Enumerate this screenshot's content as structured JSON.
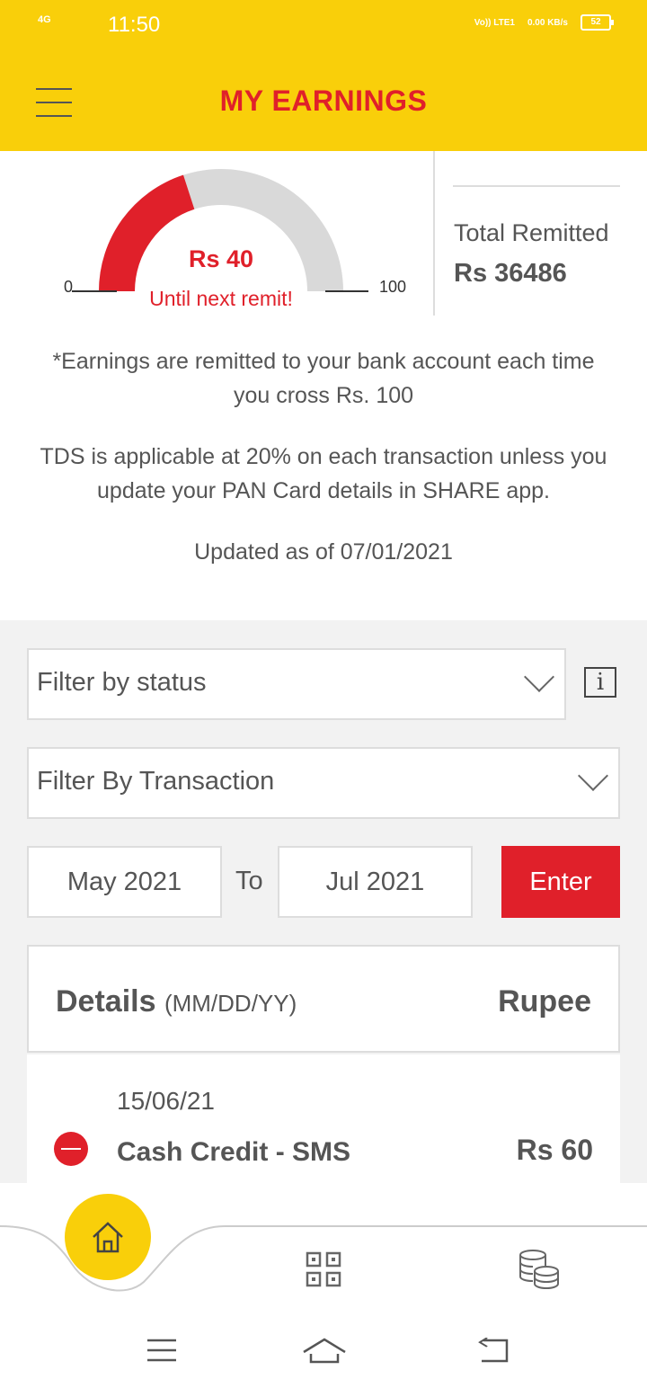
{
  "status_bar": {
    "network": "4G",
    "time": "11:50",
    "volte": "Vo)) LTE1",
    "speed": "0.00 KB/s",
    "battery": "52"
  },
  "header": {
    "title": "MY EARNINGS"
  },
  "gauge": {
    "amount_label": "Rs 40",
    "caption": "Until next remit!",
    "min_label": "0",
    "max_label": "100",
    "value": 40,
    "min": 0,
    "max": 100,
    "fill_color": "#e0202a",
    "track_color": "#d9d9d9"
  },
  "total_remitted": {
    "label": "Total Remitted",
    "value": "Rs 36486"
  },
  "notes": {
    "remit_note": "*Earnings are remitted to your bank account each time you cross Rs. 100",
    "tds_note": "TDS is applicable at 20% on each transaction unless you update your PAN Card details in SHARE app.",
    "updated": "Updated as of 07/01/2021"
  },
  "filters": {
    "status_placeholder": "Filter by status",
    "transaction_placeholder": "Filter By Transaction",
    "info_icon": "i",
    "from_date": "May 2021",
    "to_label": "To",
    "to_date": "Jul 2021",
    "enter_label": "Enter"
  },
  "details": {
    "title": "Details",
    "date_format": "(MM/DD/YY)",
    "amount_header": "Rupee",
    "rows": [
      {
        "date": "15/06/21",
        "name": "Cash Credit - SMS",
        "amount": "Rs 60",
        "status_icon": "minus-circle-icon"
      }
    ]
  },
  "bottom_nav": {
    "items": [
      "home-icon",
      "qr-code-icon",
      "coins-icon"
    ]
  },
  "colors": {
    "brand_yellow": "#f9cf0a",
    "brand_red": "#e0202a"
  }
}
